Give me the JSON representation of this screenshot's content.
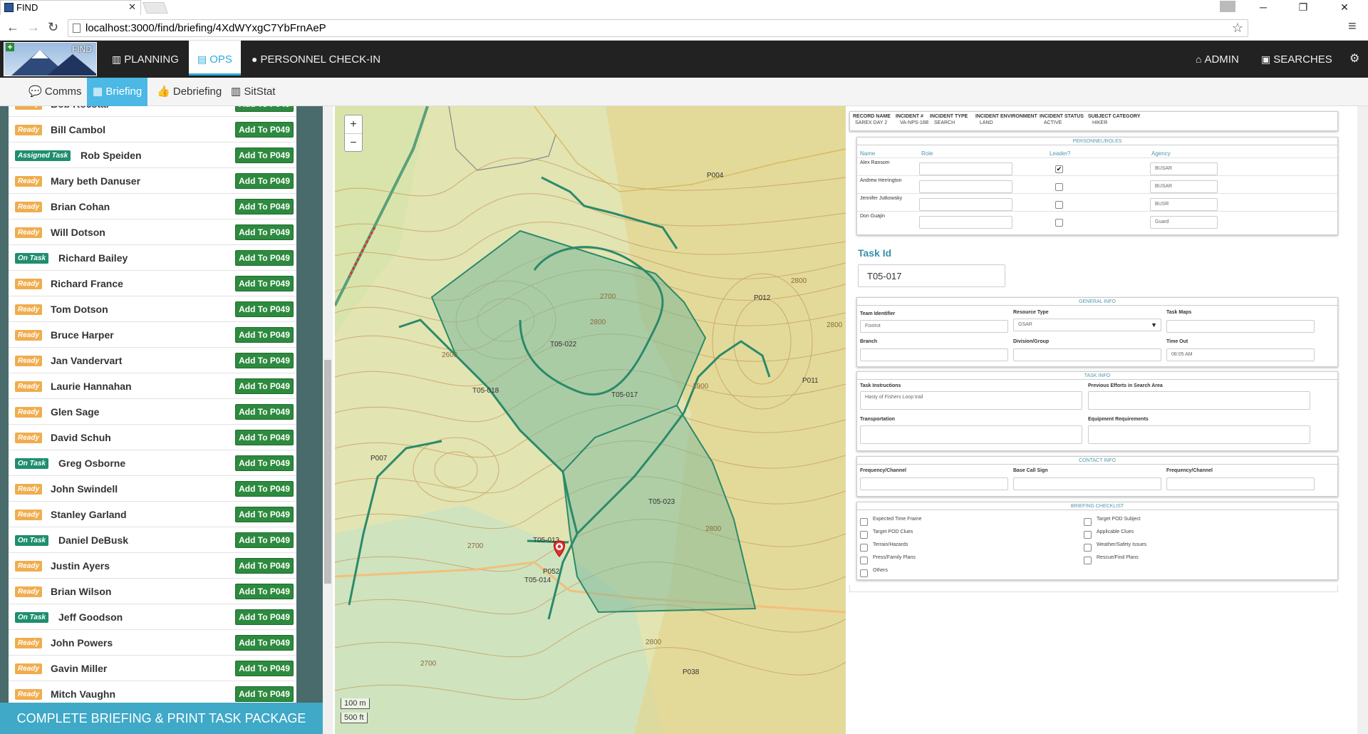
{
  "browser": {
    "tab_title": "FIND",
    "url": "localhost:3000/find/briefing/4XdWYxgC7YbFrnAeP"
  },
  "navbar": {
    "logo_text": "FIND",
    "items": [
      {
        "label": "PLANNING",
        "icon": "map-icon"
      },
      {
        "label": "OPS",
        "icon": "file-icon"
      },
      {
        "label": "PERSONNEL CHECK-IN",
        "icon": "users-icon"
      }
    ],
    "right_items": [
      {
        "label": "ADMIN",
        "icon": "home-icon"
      },
      {
        "label": "SEARCHES",
        "icon": "inbox-icon"
      }
    ]
  },
  "subnav": {
    "items": [
      {
        "label": "Comms",
        "icon": "comment-icon"
      },
      {
        "label": "Briefing",
        "icon": "card-icon"
      },
      {
        "label": "Debriefing",
        "icon": "thumbs-up-icon"
      },
      {
        "label": "SitStat",
        "icon": "map-icon"
      }
    ]
  },
  "personnel": {
    "add_label": "Add To P049",
    "rows": [
      {
        "status": "Ready",
        "name": "Bob Koestar"
      },
      {
        "status": "Ready",
        "name": "Bill Cambol"
      },
      {
        "status": "Assigned Task",
        "name": "Rob Speiden"
      },
      {
        "status": "Ready",
        "name": "Mary beth Danuser"
      },
      {
        "status": "Ready",
        "name": "Brian Cohan"
      },
      {
        "status": "Ready",
        "name": "Will Dotson"
      },
      {
        "status": "On Task",
        "name": "Richard Bailey"
      },
      {
        "status": "Ready",
        "name": "Richard France"
      },
      {
        "status": "Ready",
        "name": "Tom Dotson"
      },
      {
        "status": "Ready",
        "name": "Bruce Harper"
      },
      {
        "status": "Ready",
        "name": "Jan Vandervart"
      },
      {
        "status": "Ready",
        "name": "Laurie Hannahan"
      },
      {
        "status": "Ready",
        "name": "Glen Sage"
      },
      {
        "status": "Ready",
        "name": "David Schuh"
      },
      {
        "status": "On Task",
        "name": "Greg Osborne"
      },
      {
        "status": "Ready",
        "name": "John Swindell"
      },
      {
        "status": "Ready",
        "name": "Stanley Garland"
      },
      {
        "status": "On Task",
        "name": "Daniel DeBusk"
      },
      {
        "status": "Ready",
        "name": "Justin Ayers"
      },
      {
        "status": "Ready",
        "name": "Brian Wilson"
      },
      {
        "status": "On Task",
        "name": "Jeff Goodson"
      },
      {
        "status": "Ready",
        "name": "John Powers"
      },
      {
        "status": "Ready",
        "name": "Gavin Miller"
      },
      {
        "status": "Ready",
        "name": "Mitch Vaughn"
      }
    ],
    "complete_button": "COMPLETE BRIEFING & PRINT TASK PACKAGE"
  },
  "map": {
    "zoom_in": "+",
    "zoom_out": "−",
    "scale_m": "100 m",
    "scale_ft": "500 ft",
    "point_labels": [
      "P004",
      "P012",
      "P011",
      "P007",
      "P052",
      "P038"
    ],
    "segment_labels": [
      "T05-022",
      "T05-018",
      "T05-017",
      "T05-023",
      "T05-013",
      "T05-014"
    ],
    "contour_labels": [
      "2700",
      "2800",
      "2600",
      "2900",
      "2800",
      "2700",
      "2800",
      "2800",
      "2800",
      "2700"
    ]
  },
  "record": {
    "headers": [
      "RECORD NAME",
      "INCIDENT #",
      "INCIDENT TYPE",
      "INCIDENT ENVIRONMENT",
      "INCIDENT STATUS",
      "SUBJECT CATEGORY"
    ],
    "values": [
      "SAREX DAY 2",
      "VA-NPS-16B",
      "SEARCH",
      "LAND",
      "ACTIVE",
      "HIKER"
    ]
  },
  "personnel_roles": {
    "title": "PERSONNEL/ROLES",
    "columns": [
      "Name",
      "Role",
      "Leader?",
      "Agency"
    ],
    "rows": [
      {
        "name": "Alex Ransom",
        "leader": true,
        "agency": "BUSAR"
      },
      {
        "name": "Andrew Herrington",
        "leader": false,
        "agency": "BUSAR"
      },
      {
        "name": "Jennifer Jutkowsky",
        "leader": false,
        "agency": "BUSR"
      },
      {
        "name": "Don Guajin",
        "leader": false,
        "agency": "Guard"
      }
    ]
  },
  "task": {
    "label": "Task Id",
    "value": "T05-017"
  },
  "general_info": {
    "title": "GENERAL INFO",
    "team_identifier_label": "Team Identifier",
    "team_identifier_value": "Foxtrot",
    "resource_type_label": "Resource Type",
    "resource_type_value": "GSAR",
    "task_maps_label": "Task Maps",
    "branch_label": "Branch",
    "division_label": "Division/Group",
    "time_out_label": "Time Out",
    "time_out_value": "08:05 AM"
  },
  "task_info": {
    "title": "TASK INFO",
    "instructions_label": "Task Instructions",
    "instructions_value": "Hasty of Fishers Loop trail",
    "previous_label": "Previous Efforts in Search Area",
    "transportation_label": "Transportation",
    "equipment_label": "Equipment Requirements"
  },
  "contact_info": {
    "title": "CONTACT INFO",
    "freq1_label": "Frequency/Channel",
    "callsign_label": "Base Call Sign",
    "freq2_label": "Frequency/Channel"
  },
  "checklist": {
    "title": "BRIEFING CHECKLIST",
    "left": [
      "Expected Time Frame",
      "Target POD Clues",
      "Terrain/Hazards",
      "Press/Family Plans",
      "Others"
    ],
    "right": [
      "Target POD Subject",
      "Applicable Clues",
      "Weather/Safety Issues",
      "Rescue/Find Plans"
    ]
  },
  "colors": {
    "navbar": "#222222",
    "accent": "#2eaadc",
    "ready": "#f0ad4e",
    "on_task": "#1e8e6e",
    "add_button": "#2d8a3e",
    "complete_button": "#3fa9c7"
  }
}
